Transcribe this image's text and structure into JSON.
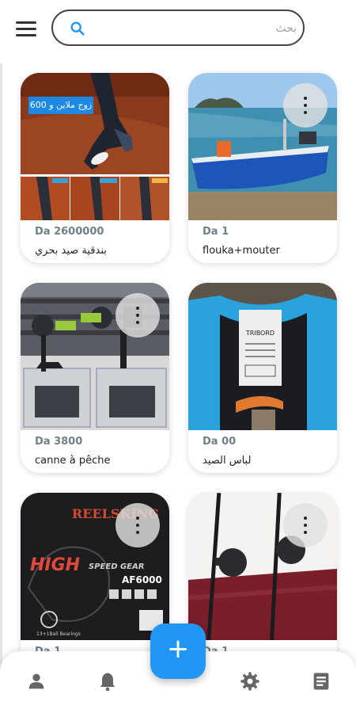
{
  "search": {
    "placeholder": "بحث"
  },
  "listings": [
    {
      "price": "Da 2600000",
      "title": "بندقية صيد بحري",
      "badge": "زوج ملاين و 600"
    },
    {
      "price": "Da 1",
      "title": "flouka+mouter"
    },
    {
      "price": "Da 3800",
      "title": "canne à pêche"
    },
    {
      "price": "Da 00",
      "title": "لباس الصيد",
      "label_text": "TRIBORD"
    },
    {
      "price": "Da 1",
      "title": "",
      "brand": "REELSKING",
      "big_text": "HIGH",
      "sub_text": "SPEED GEAR",
      "model": "AF6000",
      "bearings": "13+1Ball Bearings"
    },
    {
      "price": "Da 1",
      "title": ""
    }
  ],
  "fab": {
    "label": "+"
  },
  "colors": {
    "accent": "#2196f3",
    "price": "#70808a"
  }
}
